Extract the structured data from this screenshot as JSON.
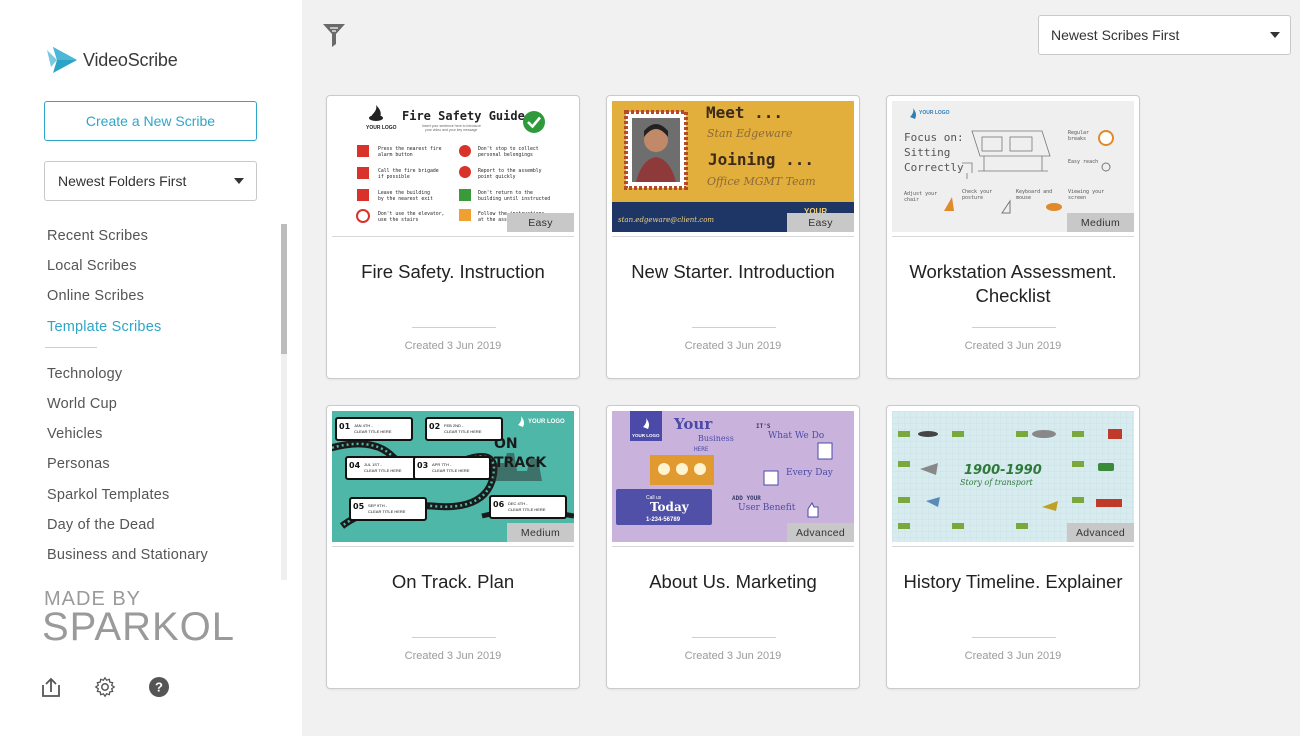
{
  "app": {
    "name": "VideoScribe"
  },
  "sidebar": {
    "create_label": "Create a New Scribe",
    "folder_sort": "Newest Folders First",
    "nav_primary": [
      "Recent Scribes",
      "Local Scribes",
      "Online Scribes",
      "Template Scribes"
    ],
    "active_item": "Template Scribes",
    "nav_secondary": [
      "Technology",
      "World Cup",
      "Vehicles",
      "Personas",
      "Sparkol Templates",
      "Day of the Dead",
      "Business and Stationary"
    ],
    "made_by": "MADE BY",
    "brand": "SPARKOL",
    "footer_icons": [
      "upload-icon",
      "gear-icon",
      "help-icon"
    ]
  },
  "toolbar": {
    "filter_icon": "filter-icon",
    "scribe_sort": "Newest Scribes First"
  },
  "colors": {
    "accent": "#2ea6c9",
    "badge": "#c8c8c8"
  },
  "cards": [
    {
      "title": "Fire Safety. Instruction",
      "date": "Created 3 Jun 2019",
      "level": "Easy",
      "thumb": {
        "heading": "Fire Safety Guide",
        "logo": "YOUR LOGO",
        "sub1": "Insert your sentence here to introduce",
        "sub2": "your video and your key message",
        "l1a": "Press the nearest fire",
        "l1b": "alarm button",
        "l2a": "Call the fire brigade",
        "l2b": "if possible",
        "l3a": "Leave the building",
        "l3b": "by the nearest exit",
        "l4a": "Don't use the elevator,",
        "l4b": "use the stairs",
        "r1a": "Don't stop to collect",
        "r1b": "personal belongings",
        "r2a": "Report to the assembly",
        "r2b": "point quickly",
        "r3a": "Don't return to the",
        "r3b": "building until instructed",
        "r4a": "Follow the instructions",
        "r4b": "at the assembly"
      }
    },
    {
      "title": "New Starter. Introduction",
      "date": "Created 3 Jun 2019",
      "level": "Easy",
      "thumb": {
        "meet": "Meet ...",
        "name": "Stan Edgeware",
        "joining": "Joining ...",
        "team": "Office MGMT Team",
        "email": "stan.edgeware@client.com",
        "logo": "YOUR"
      }
    },
    {
      "title": "Workstation Assessment. Checklist",
      "date": "Created 3 Jun 2019",
      "level": "Medium",
      "thumb": {
        "logo": "YOUR LOGO",
        "heading1": "Focus on:",
        "heading2": "Sitting",
        "heading3": "Correctly",
        "tip1a": "Regular",
        "tip1b": "breaks",
        "tip2": "Easy reach",
        "tip3a": "Adjust your",
        "tip3b": "chair",
        "tip4a": "Check your",
        "tip4b": "posture",
        "tip5a": "Keyboard and",
        "tip5b": "mouse",
        "tip6a": "Viewing your",
        "tip6b": "screen"
      }
    },
    {
      "title": "On Track. Plan",
      "date": "Created 3 Jun 2019",
      "level": "Medium",
      "thumb": {
        "heading1": "ON",
        "heading2": "TRACK",
        "logo": "YOUR LOGO",
        "step1": "01",
        "step2": "02",
        "step3": "03",
        "step4": "04",
        "step5": "05",
        "step6": "06",
        "s1a": "JAN 4TH -",
        "s1b": "CLEAR TITLE HERE",
        "s2a": "FEB 2ND -",
        "s2b": "CLEAR TITLE HERE",
        "s3a": "APR 7TH -",
        "s3b": "CLEAR TITLE HERE",
        "s4a": "JUL 1ST -",
        "s4b": "CLEAR TITLE HERE",
        "s5a": "SEP 9TH -",
        "s5b": "CLEAR TITLE HERE",
        "s6a": "DEC 4TH -",
        "s6b": "CLEAR TITLE HERE"
      }
    },
    {
      "title": "About Us. Marketing",
      "date": "Created 3 Jun 2019",
      "level": "Advanced",
      "thumb": {
        "logo": "YOUR LOGO",
        "your": "Your",
        "business": "Business",
        "here": "HERE",
        "its": "IT'S",
        "what": "What We Do",
        "every": "Every Day",
        "call": "Call us",
        "today": "Today",
        "phone": "1-234-56789",
        "add": "ADD YOUR",
        "benefit": "User Benefit"
      }
    },
    {
      "title": "History Timeline. Explainer",
      "date": "Created 3 Jun 2019",
      "level": "Advanced",
      "thumb": {
        "years": "1900-1990",
        "story": "Story of transport"
      }
    }
  ]
}
